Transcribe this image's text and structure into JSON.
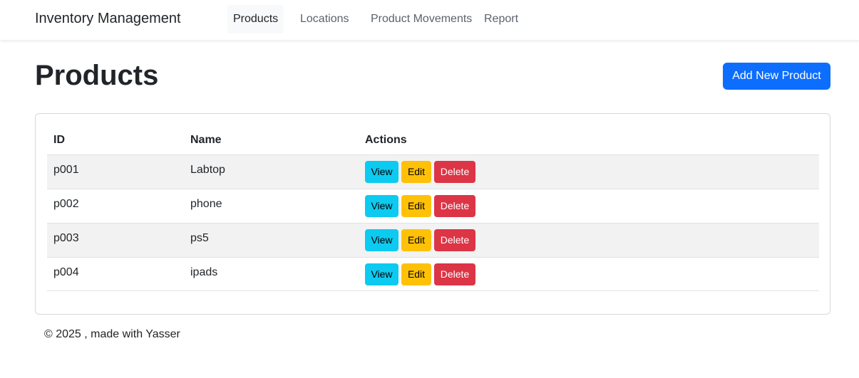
{
  "navbar": {
    "brand": "Inventory Management",
    "links": [
      "Products",
      "Locations",
      "Product Movements",
      "Report"
    ],
    "active": "Products"
  },
  "page": {
    "title": "Products",
    "add_button": "Add New Product"
  },
  "table": {
    "headers": [
      "ID",
      "Name",
      "Actions"
    ],
    "rows": [
      {
        "id": "p001",
        "name": "Labtop"
      },
      {
        "id": "p002",
        "name": "phone"
      },
      {
        "id": "p003",
        "name": "ps5"
      },
      {
        "id": "p004",
        "name": "ipads"
      }
    ],
    "actions": {
      "view": "View",
      "edit": "Edit",
      "delete": "Delete"
    }
  },
  "footer": {
    "text": "© 2025 , made with Yasser"
  },
  "colors": {
    "primary": "#0d6efd",
    "info": "#0dcaf0",
    "warning": "#ffc107",
    "danger": "#dc3545"
  }
}
